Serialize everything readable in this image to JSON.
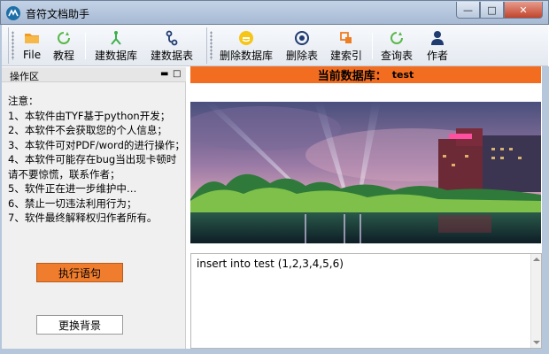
{
  "window": {
    "title": "音符文档助手",
    "min": "—",
    "max": "□",
    "close": "✕"
  },
  "toolbar": {
    "buttons": [
      {
        "label": "File",
        "icon": "folder-icon"
      },
      {
        "label": "教程",
        "icon": "refresh-icon"
      },
      {
        "label": "建数据库",
        "icon": "branch-icon"
      },
      {
        "label": "建数据表",
        "icon": "link-icon"
      },
      {
        "label": "删除数据库",
        "icon": "smiley-icon"
      },
      {
        "label": "删除表",
        "icon": "power-icon"
      },
      {
        "label": "建索引",
        "icon": "index-icon"
      },
      {
        "label": "查询表",
        "icon": "refresh-icon"
      },
      {
        "label": "作者",
        "icon": "user-icon"
      }
    ]
  },
  "left_panel": {
    "title": "操作区",
    "notice": "注意：\n1、本软件由TYF基于python开发；\n2、本软件不会获取您的个人信息；\n3、本软件可对PDF/word的进行操作；\n4、本软件可能存在bug当出现卡顿时请不要惊慌，联系作者；\n5、软件正在进一步维护中…\n6、禁止一切违法利用行为；\n7、软件最终解释权归作者所有。",
    "exec_button": "执行语句",
    "bg_button": "更换背景"
  },
  "main": {
    "db_label": "当前数据库：",
    "db_name": "test",
    "editor_text": "insert into test (1,2,3,4,5,6)"
  },
  "colors": {
    "accent": "#f26d20",
    "titlebar": "#b6c6db"
  }
}
